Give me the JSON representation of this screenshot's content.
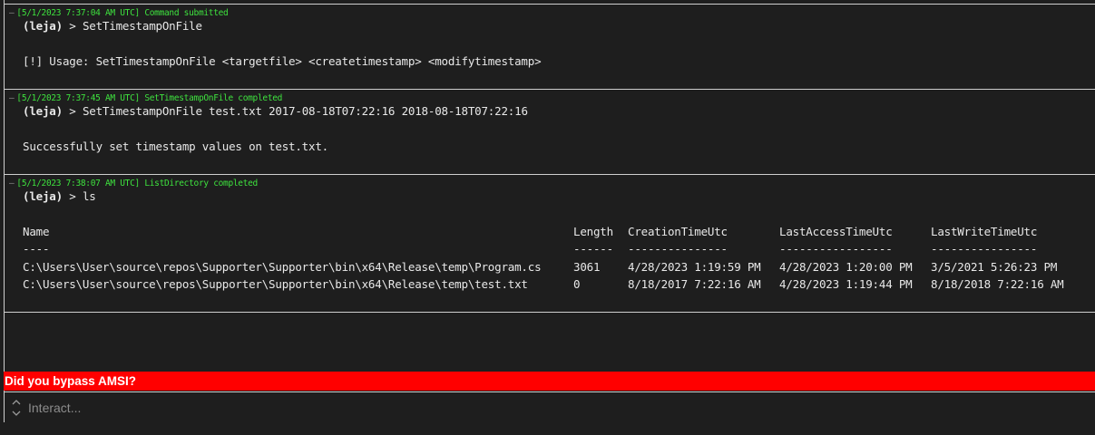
{
  "entries": [
    {
      "header": "[5/1/2023 7:37:04 AM UTC] Command submitted",
      "prompt_name": "(leja)",
      "command": " > SetTimestampOnFile",
      "output": "[!] Usage: SetTimestampOnFile <targetfile> <createtimestamp> <modifytimestamp>"
    },
    {
      "header": "[5/1/2023 7:37:45 AM UTC] SetTimestampOnFile completed",
      "prompt_name": "(leja)",
      "command": " > SetTimestampOnFile test.txt 2017-08-18T07:22:16 2018-08-18T07:22:16",
      "output": "Successfully set timestamp values on test.txt."
    },
    {
      "header": "[5/1/2023 7:38:07 AM UTC] ListDirectory completed",
      "prompt_name": "(leja)",
      "command": " > ls",
      "table": {
        "headers": [
          "Name",
          "Length",
          "CreationTimeUtc",
          "LastAccessTimeUtc",
          "LastWriteTimeUtc"
        ],
        "dividers": [
          "----",
          "------",
          "---------------",
          "-----------------",
          "----------------"
        ],
        "rows": [
          [
            "C:\\Users\\User\\source\\repos\\Supporter\\Supporter\\bin\\x64\\Release\\temp\\Program.cs",
            "3061",
            "4/28/2023 1:19:59 PM",
            "4/28/2023 1:20:00 PM",
            "3/5/2021 5:26:23 PM"
          ],
          [
            "C:\\Users\\User\\source\\repos\\Supporter\\Supporter\\bin\\x64\\Release\\temp\\test.txt",
            "0",
            "8/18/2017 7:22:16 AM",
            "4/28/2023 1:19:44 PM",
            "8/18/2018 7:22:16 AM"
          ]
        ]
      }
    }
  ],
  "warning": "Did you bypass AMSI?",
  "input": {
    "placeholder": "Interact...",
    "value": ""
  },
  "colors": {
    "header_green": "#3ee23e",
    "warning_red": "#ff0000",
    "background": "#1e1e1e"
  }
}
